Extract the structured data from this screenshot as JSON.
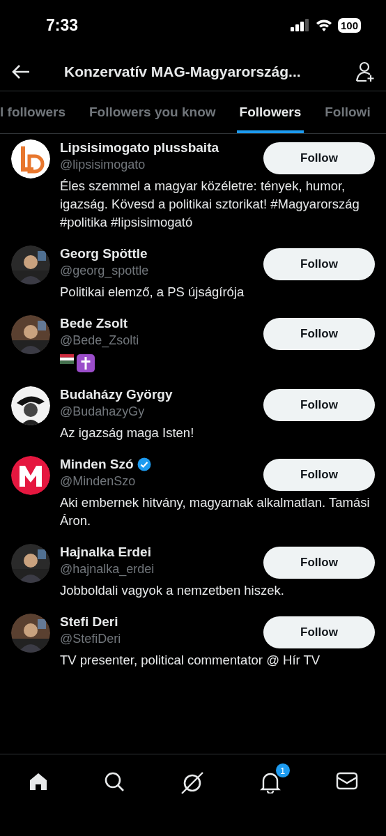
{
  "status_bar": {
    "time": "7:33",
    "battery": "100"
  },
  "header": {
    "title": "Konzervatív MAG-Magyarország..."
  },
  "tabs": [
    {
      "label": "l followers",
      "selected": false
    },
    {
      "label": "Followers you know",
      "selected": false
    },
    {
      "label": "Followers",
      "selected": true
    },
    {
      "label": "Followi",
      "selected": false
    }
  ],
  "users": [
    {
      "kind": "text",
      "avatar": {
        "kind": "logo-ld"
      },
      "name": "Lipsisimogato plussbaita",
      "handle": "@lipsisimogato",
      "bio": "Éles szemmel a magyar közéletre: tények, humor, igazság. Kövesd a politikai sztorikat! #Magyarország #politika #lipsisimogató",
      "verified": false,
      "button": "Follow"
    },
    {
      "kind": "text",
      "name": "Georg Spöttle",
      "handle": "@georg_spottle",
      "bio": "Politikai elemző, a PS újságírója",
      "verified": false,
      "button": "Follow"
    },
    {
      "kind": "emoji",
      "name": "Bede Zsolt",
      "handle": "@Bede_Zsolti",
      "verified": false,
      "button": "Follow"
    },
    {
      "kind": "text",
      "avatar": {
        "kind": "drawing"
      },
      "name": "Budaházy György",
      "handle": "@BudahazyGy",
      "bio": "Az igazság maga Isten!",
      "verified": false,
      "button": "Follow"
    },
    {
      "kind": "text",
      "avatar": {
        "kind": "logo-m"
      },
      "name": "Minden Szó",
      "handle": "@MindenSzo",
      "bio": "Aki embernek hitvány, magyarnak alkalmatlan. Tamási Áron.",
      "verified": true,
      "button": "Follow"
    },
    {
      "kind": "text",
      "name": "Hajnalka Erdei",
      "handle": "@hajnalka_erdei",
      "bio": "Jobboldali vagyok a nemzetben hiszek.",
      "verified": false,
      "button": "Follow"
    },
    {
      "kind": "text",
      "name": "Stefi Deri",
      "handle": "@StefiDeri",
      "bio": "TV presenter, political commentator @ Hír TV",
      "verified": false,
      "button": "Follow"
    }
  ],
  "bottom_nav": {
    "notification_badge": "1"
  }
}
